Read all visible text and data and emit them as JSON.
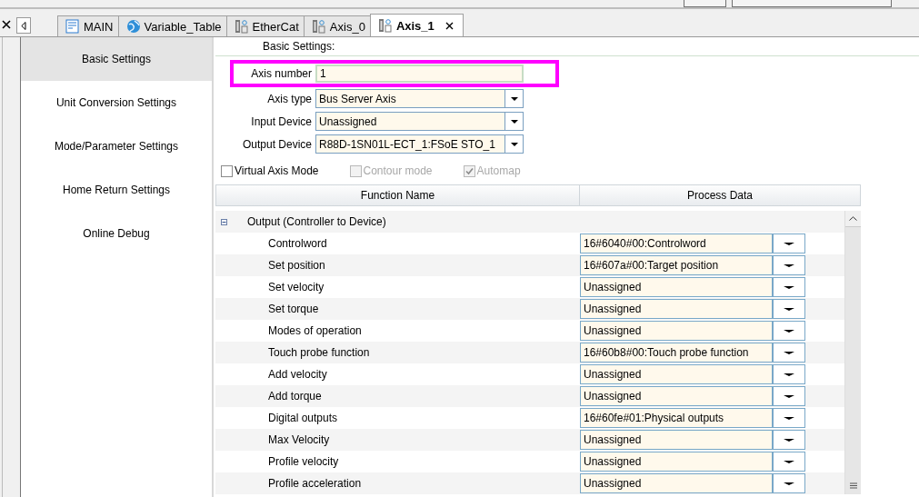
{
  "tabs": [
    {
      "label": "MAIN",
      "kind": "program",
      "selected": false
    },
    {
      "label": "Variable_Table",
      "kind": "globe",
      "selected": false
    },
    {
      "label": "EtherCat",
      "kind": "device",
      "selected": false
    },
    {
      "label": "Axis_0",
      "kind": "device",
      "selected": false
    },
    {
      "label": "Axis_1",
      "kind": "device",
      "selected": true,
      "closable": true
    }
  ],
  "sidebar": {
    "items": [
      {
        "label": "Basic Settings",
        "selected": true
      },
      {
        "label": "Unit Conversion Settings",
        "selected": false
      },
      {
        "label": "Mode/Parameter Settings",
        "selected": false
      },
      {
        "label": "Home Return Settings",
        "selected": false
      },
      {
        "label": "Online Debug",
        "selected": false
      }
    ]
  },
  "section_title": "Basic Settings:",
  "axis_number": {
    "label": "Axis number",
    "value": "1",
    "highlighted": true
  },
  "dropdowns": [
    {
      "label": "Axis type",
      "value": "Bus Server Axis"
    },
    {
      "label": "Input Device",
      "value": "Unassigned"
    },
    {
      "label": "Output Device",
      "value": "R88D-1SN01L-ECT_1:FSoE STO_1"
    }
  ],
  "checkboxes": [
    {
      "label": "Virtual Axis Mode",
      "checked": false,
      "disabled": false
    },
    {
      "label": "Contour mode",
      "checked": false,
      "disabled": true
    },
    {
      "label": "Automap",
      "checked": true,
      "disabled": true
    }
  ],
  "table": {
    "columns": [
      "Function Name",
      "Process Data"
    ],
    "rows": [
      {
        "kind": "group",
        "name": "Output (Controller to Device)",
        "expanded": true
      },
      {
        "kind": "item",
        "name": "Controlword",
        "value": "16#6040#00:Controlword"
      },
      {
        "kind": "item",
        "name": "Set position",
        "value": "16#607a#00:Target position"
      },
      {
        "kind": "item",
        "name": "Set velocity",
        "value": "Unassigned"
      },
      {
        "kind": "item",
        "name": "Set torque",
        "value": "Unassigned"
      },
      {
        "kind": "item",
        "name": "Modes of operation",
        "value": "Unassigned"
      },
      {
        "kind": "item",
        "name": "Touch probe function",
        "value": "16#60b8#00:Touch probe function"
      },
      {
        "kind": "item",
        "name": "Add velocity",
        "value": "Unassigned"
      },
      {
        "kind": "item",
        "name": "Add torque",
        "value": "Unassigned"
      },
      {
        "kind": "item",
        "name": "Digital outputs",
        "value": "16#60fe#01:Physical outputs"
      },
      {
        "kind": "item",
        "name": "Max Velocity",
        "value": "Unassigned"
      },
      {
        "kind": "item",
        "name": "Profile velocity",
        "value": "Unassigned"
      },
      {
        "kind": "item",
        "name": "Profile acceleration",
        "value": "Unassigned"
      }
    ]
  }
}
